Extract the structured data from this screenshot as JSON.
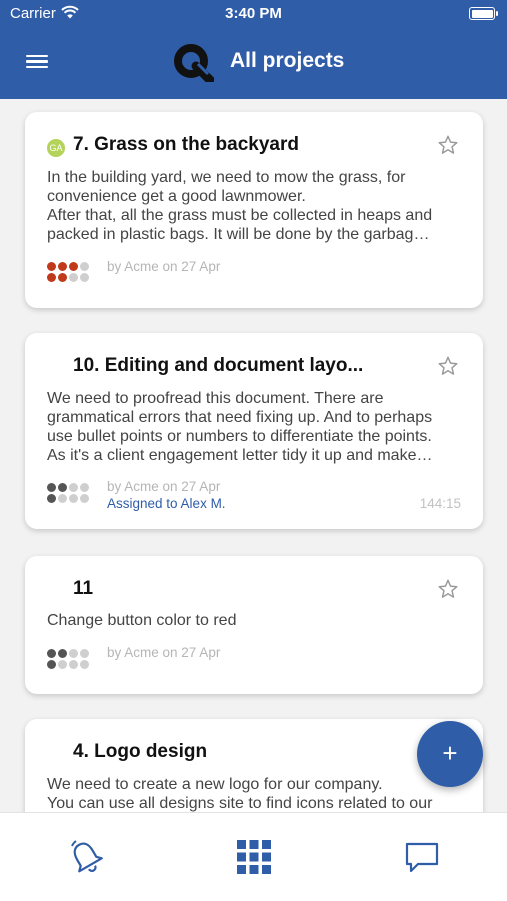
{
  "status_bar": {
    "carrier": "Carrier",
    "time": "3:40 PM"
  },
  "app_bar": {
    "title": "All projects"
  },
  "theme": {
    "primary": "#2f5da8",
    "priority_high": "#c0391b",
    "priority_mid": "#555555",
    "inactive_dot": "#cfcfcf"
  },
  "cards": [
    {
      "avatar": "GA",
      "title": "7. Grass on the backyard",
      "desc1": "In the building yard, we need to mow the grass, for",
      "desc2": "convenience get a good lawnmower.",
      "desc3": "After that, all the grass must be collected in heaps and",
      "desc4": "packed in plastic bags. It will be done by the garbag…",
      "meta": "by Acme on 27 Apr",
      "priority": 5
    },
    {
      "title": "10. Editing and document layo...",
      "desc1": "We need to proofread this document. There are",
      "desc2": "grammatical errors that need fixing up. And to perhaps",
      "desc3": "use bullet points or numbers to differentiate the points.",
      "desc4": "As it's a client engagement letter tidy it up and make…",
      "meta": "by Acme on 27 Apr",
      "assigned": "Assigned to Alex M.",
      "time_spent": "144:15",
      "priority": 3
    },
    {
      "title": "11",
      "desc1": "Change button color to red",
      "meta": "by Acme on 27 Apr",
      "priority": 3
    },
    {
      "title": "4. Logo design",
      "desc1": "We need to create a new logo for our company.",
      "desc2": "You can use all designs site to find icons related to our"
    }
  ],
  "fab": {
    "label": "+"
  },
  "icons": {
    "nav_left": "bell-icon",
    "nav_center": "grid-icon",
    "nav_right": "chat-icon",
    "fav": "star-outline-icon"
  }
}
